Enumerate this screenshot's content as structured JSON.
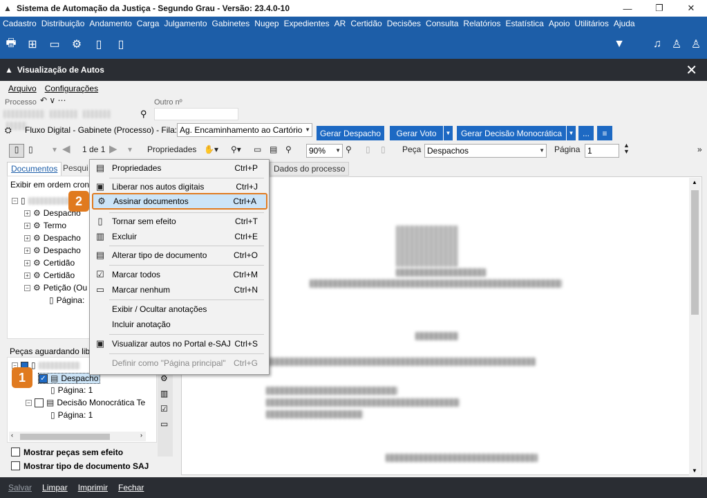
{
  "window": {
    "title": "Sistema de Automação da Justiça - Segundo Grau - Versão: 23.4.0-10",
    "min": "—",
    "restore": "❐",
    "close": "✕"
  },
  "menu": [
    "Cadastro",
    "Distribuição",
    "Andamento",
    "Carga",
    "Julgamento",
    "Gabinetes",
    "Nugep",
    "Expedientes",
    "AR",
    "Certidão",
    "Decisões",
    "Consulta",
    "Relatórios",
    "Estatística",
    "Apoio",
    "Utilitários",
    "Ajuda"
  ],
  "subwindow": {
    "title": "Visualização de Autos",
    "menu": [
      "Arquivo",
      "Configurações"
    ]
  },
  "form": {
    "processo_label": "Processo",
    "outro_label": "Outro nº",
    "fluxo_text": "Fluxo Digital - Gabinete (Processo) - Fila:",
    "fila_value": "Ag. Encaminhamento ao Cartório",
    "btn_despacho": "Gerar Despacho",
    "btn_voto": "Gerar Voto",
    "btn_decisao": "Gerar Decisão Monocrática",
    "btn_more": "..."
  },
  "toolbar": {
    "page_of": "1 de 1",
    "propriedades": "Propriedades",
    "zoom": "90%",
    "peca_label": "Peça",
    "peca_value": "Despachos",
    "pagina_label": "Página",
    "pagina_value": "1"
  },
  "left": {
    "tab_documentos": "Documentos",
    "tab_pesquisa": "Pesqui",
    "order": "Exibir em ordem cronc",
    "tree": [
      "Despacho",
      "Termo",
      "Despacho",
      "Despacho",
      "Certidão",
      "Certidão",
      "Petição (Ou",
      "Página:"
    ],
    "pending_header": "Peças aguardando libe",
    "pending": [
      "Despacho",
      "Página: 1",
      "Decisão Monocrática Te",
      "Página: 1"
    ],
    "chk_sem_efeito": "Mostrar peças sem efeito",
    "chk_tipo_doc": "Mostrar tipo de documento SAJ"
  },
  "right_tab": "Dados do processo",
  "context_menu": [
    {
      "label": "Propriedades",
      "shortcut": "Ctrl+P",
      "icon": "properties-icon"
    },
    {
      "label": "Liberar nos autos digitais",
      "shortcut": "Ctrl+J",
      "icon": "release-icon"
    },
    {
      "label": "Assinar documentos",
      "shortcut": "Ctrl+A",
      "icon": "sign-icon"
    },
    {
      "label": "Tornar sem efeito",
      "shortcut": "Ctrl+T",
      "icon": "void-icon"
    },
    {
      "label": "Excluir",
      "shortcut": "Ctrl+E",
      "icon": "delete-icon"
    },
    {
      "label": "Alterar tipo de documento",
      "shortcut": "Ctrl+O",
      "icon": "change-type-icon"
    },
    {
      "label": "Marcar todos",
      "shortcut": "Ctrl+M",
      "icon": "check-all-icon"
    },
    {
      "label": "Marcar nenhum",
      "shortcut": "Ctrl+N",
      "icon": "uncheck-all-icon"
    },
    {
      "label": "Exibir / Ocultar anotações",
      "shortcut": "",
      "icon": ""
    },
    {
      "label": "Incluir anotação",
      "shortcut": "",
      "icon": ""
    },
    {
      "label": "Visualizar autos no Portal e-SAJ",
      "shortcut": "Ctrl+S",
      "icon": "portal-icon"
    },
    {
      "label": "Definir como \"Página principal\"",
      "shortcut": "Ctrl+G",
      "icon": ""
    }
  ],
  "badges": {
    "one": "1",
    "two": "2"
  },
  "bottom": [
    "Salvar",
    "Limpar",
    "Imprimir",
    "Fechar"
  ],
  "colors": {
    "menubar": "#1d5ea8",
    "button": "#1d69c3",
    "highlight": "#e07a1f"
  }
}
